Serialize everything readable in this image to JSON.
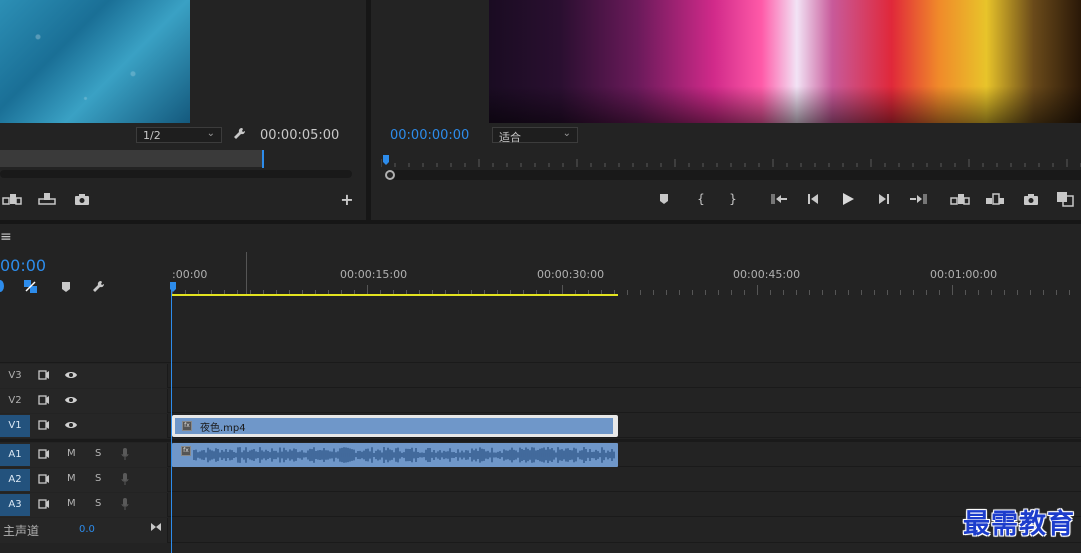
{
  "source_monitor": {
    "resolution_select": "1/2",
    "timecode": "00:00:05:00"
  },
  "program_monitor": {
    "timecode": "00:00:00:00",
    "zoom_select": "适合"
  },
  "timeline": {
    "menu_icon": "≡",
    "timecode": "00:00",
    "ruler_labels": [
      ":00:00",
      "00:00:15:00",
      "00:00:30:00",
      "00:00:45:00",
      "00:01:00:00"
    ],
    "tracks": {
      "video": [
        {
          "label": "V3",
          "active": false
        },
        {
          "label": "V2",
          "active": false
        },
        {
          "label": "V1",
          "active": true
        }
      ],
      "audio": [
        {
          "label": "A1",
          "active": true,
          "mute": "M",
          "solo": "S"
        },
        {
          "label": "A2",
          "active": true,
          "mute": "M",
          "solo": "S"
        },
        {
          "label": "A3",
          "active": true,
          "mute": "M",
          "solo": "S"
        }
      ],
      "master": {
        "label": "主声道",
        "value": "0.0"
      }
    },
    "clip": {
      "name": "夜色.mp4",
      "fx_label": "fx"
    }
  },
  "watermark": "最需教育",
  "colors": {
    "accent_blue": "#2d8ceb",
    "clip_blue": "#6f97c9",
    "work_area_yellow": "#e3e320",
    "target_blue": "#23527d"
  }
}
